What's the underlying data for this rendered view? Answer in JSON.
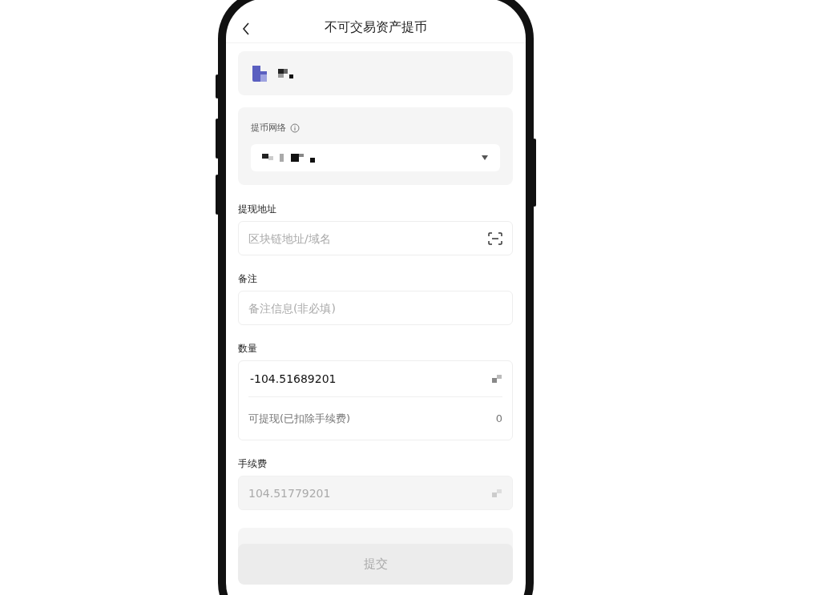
{
  "header": {
    "title": "不可交易资产提币"
  },
  "network": {
    "label": "提币网络"
  },
  "address": {
    "label": "提现地址",
    "placeholder": "区块链地址/域名"
  },
  "memo": {
    "label": "备注",
    "placeholder": "备注信息(非必填)"
  },
  "amount": {
    "label": "数量",
    "value": "-104.51689201",
    "available_label": "可提现(已扣除手续费)",
    "available_value": "0"
  },
  "fee": {
    "label": "手续费",
    "value": "104.51779201"
  },
  "submit": {
    "label": "提交",
    "disabled": true
  }
}
